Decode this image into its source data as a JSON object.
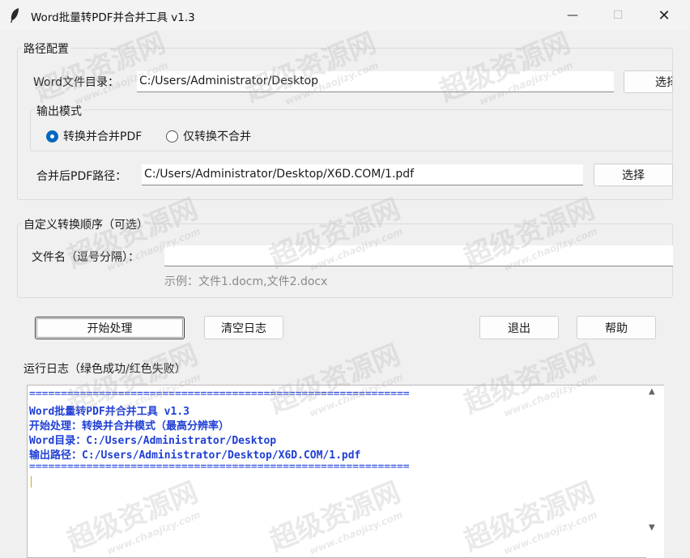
{
  "window": {
    "title": "Word批量转PDF并合并工具 v1.3",
    "minimize": "—",
    "maximize": "☐",
    "close": "✕"
  },
  "path_config": {
    "group_label": "路径配置",
    "word_dir_label": "Word文件目录：",
    "word_dir_value": "C:/Users/Administrator/Desktop",
    "select_button": "选择",
    "output_mode_label": "输出模式",
    "mode_merge": "转换并合并PDF",
    "mode_convert_only": "仅转换不合并",
    "selected_mode": "merge",
    "merged_path_label": "合并后PDF路径：",
    "merged_path_value": "C:/Users/Administrator/Desktop/X6D.COM/1.pdf",
    "merged_select_button": "选择"
  },
  "custom_order": {
    "group_label": "自定义转换顺序（可选）",
    "filename_label": "文件名（逗号分隔）：",
    "filename_value": "",
    "example": "示例：文件1.docm,文件2.docx"
  },
  "actions": {
    "start": "开始处理",
    "clear_log": "清空日志",
    "exit": "退出",
    "help": "帮助"
  },
  "log": {
    "label": "运行日志（绿色成功/红色失败）",
    "lines": [
      "============================================================",
      "Word批量转PDF并合并工具 v1.3",
      "开始处理：转换并合并模式（最高分辨率）",
      "Word目录：C:/Users/Administrator/Desktop",
      "输出路径：C:/Users/Administrator/Desktop/X6D.COM/1.pdf",
      "============================================================"
    ]
  },
  "watermark": {
    "text": "超级资源网",
    "url": "www.chaojizy.com"
  }
}
